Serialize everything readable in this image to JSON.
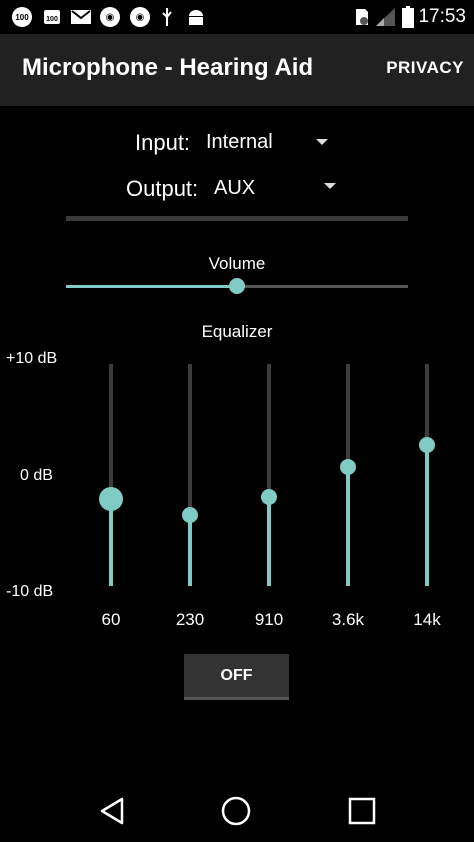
{
  "status_bar": {
    "time": "17:53",
    "icons": [
      "badge-100-icon",
      "badge-100-icon",
      "gmail-icon",
      "app-icon",
      "app-icon",
      "usb-icon",
      "android-icon",
      "sd-card-icon",
      "signal-icon",
      "battery-icon"
    ]
  },
  "app_bar": {
    "title": "Microphone - Hearing Aid",
    "privacy_label": "PRIVACY"
  },
  "input": {
    "label": "Input:",
    "value": "Internal"
  },
  "output": {
    "label": "Output:",
    "value": "AUX"
  },
  "volume": {
    "label": "Volume",
    "level": 0.5
  },
  "equalizer": {
    "label": "Equalizer",
    "db_max": "+10 dB",
    "db_mid": "0 dB",
    "db_min": "-10 dB",
    "bands": [
      {
        "freq": "60",
        "db": -2.2
      },
      {
        "freq": "230",
        "db": -3.6
      },
      {
        "freq": "910",
        "db": -2.0
      },
      {
        "freq": "3.6k",
        "db": 0.7
      },
      {
        "freq": "14k",
        "db": 2.7
      }
    ]
  },
  "power_button": {
    "label": "OFF"
  },
  "colors": {
    "accent": "#80cbc4",
    "appbar": "#212121",
    "background": "#000000"
  }
}
